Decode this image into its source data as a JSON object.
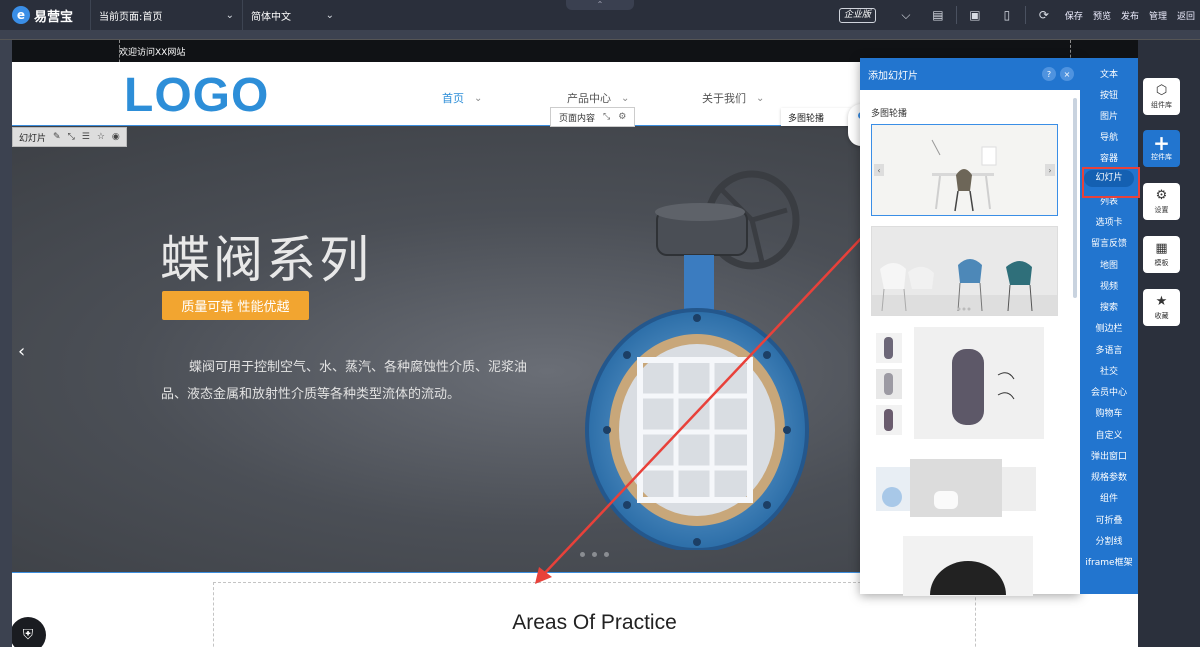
{
  "toolbar": {
    "brand": "易营宝",
    "page_select": "当前页面:首页",
    "lang_select": "简体中文",
    "edition_badge": "企业版",
    "actions": [
      "保存",
      "预览",
      "发布",
      "管理",
      "返回"
    ]
  },
  "page": {
    "welcome_text": "欢迎访问XX网站",
    "logo_text": "LOGO",
    "nav": [
      {
        "label": "首页"
      },
      {
        "label": "产品中心"
      },
      {
        "label": "关于我们"
      }
    ],
    "page_content_tag": "页面内容",
    "slide_tag": "幻灯片",
    "banner": {
      "title": "蝶阀系列",
      "tagline": "质量可靠  性能优越",
      "description": "蝶阀可用于控制空气、水、蒸汽、各种腐蚀性介质、泥浆油品、液态金属和放射性介质等各种类型流体的流动。"
    },
    "section_title": "Areas Of Practice",
    "multi_carousel_label": "多图轮播"
  },
  "panel": {
    "title": "添加幻灯片",
    "help_glyph": "?",
    "close_glyph": "×",
    "subtitle": "多图轮播"
  },
  "components": [
    "文本",
    "按钮",
    "图片",
    "导航",
    "容器",
    "幻灯片",
    "列表",
    "选项卡",
    "留言反馈",
    "地图",
    "视频",
    "搜索",
    "侧边栏",
    "多语言",
    "社交",
    "会员中心",
    "购物车",
    "自定义",
    "弹出窗口",
    "规格参数",
    "组件",
    "可折叠",
    "分割线",
    "iframe框架"
  ],
  "active_component": "幻灯片",
  "sidebar": {
    "buttons": [
      "组件库",
      "控件库",
      "设置",
      "模板",
      "收藏"
    ]
  },
  "colors": {
    "toolbar_bg": "#2a2f3b",
    "accent_blue": "#2275cf",
    "logo_blue": "#2d8ed8",
    "tag_orange": "#f2a530",
    "highlight_red": "#e8413a"
  }
}
